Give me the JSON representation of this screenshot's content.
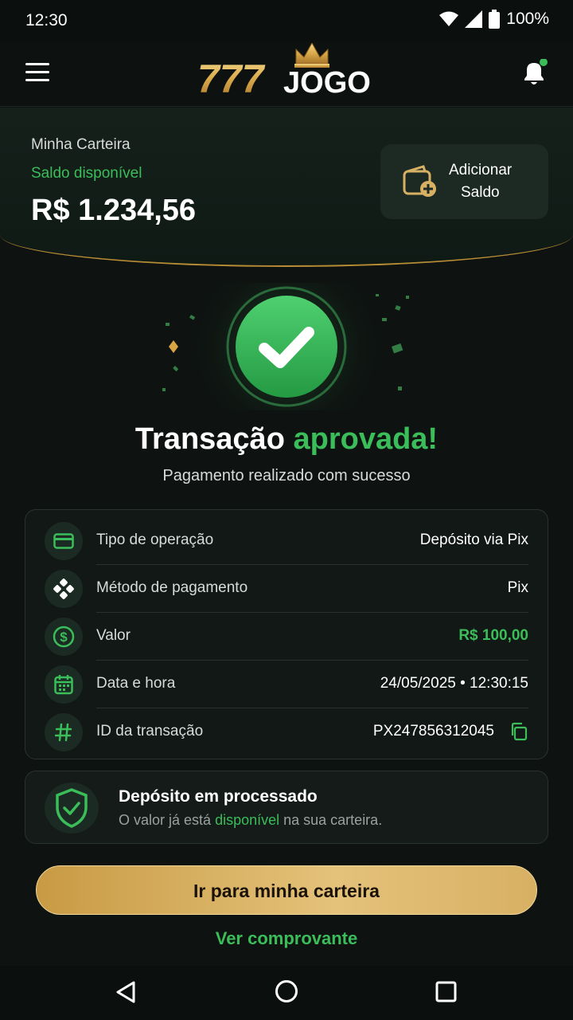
{
  "status_bar": {
    "time": "12:30",
    "battery": "100%"
  },
  "header": {
    "logo_number": "777",
    "logo_word": "JOGO"
  },
  "wallet": {
    "title": "Minha Carteira",
    "subtitle": "Saldo disponível",
    "balance": "R$ 1.234,56",
    "add_line1": "Adicionar",
    "add_line2": "Saldo"
  },
  "success": {
    "title_part1": "Transação",
    "title_part2": "aprovada!",
    "subtitle": "Pagamento realizado com sucesso"
  },
  "details": [
    {
      "label": "Tipo de operação",
      "value": "Depósito via Pix",
      "icon": "card-icon"
    },
    {
      "label": "Método de pagamento",
      "value": "Pix",
      "icon": "pix-icon"
    },
    {
      "label": "Valor",
      "value": "R$ 100,00",
      "icon": "dollar-circle-icon"
    },
    {
      "label": "Data e hora",
      "value": "24/05/2025 • 12:30:15",
      "icon": "calendar-icon"
    },
    {
      "label": "ID da transação",
      "value": "PX247856312045",
      "icon": "hash-icon"
    }
  ],
  "processed": {
    "title": "Depósito em processado",
    "text_before": "O valor já está ",
    "text_highlight": "disponível",
    "text_after": " na sua carteira."
  },
  "actions": {
    "primary": "Ir para minha carteira",
    "secondary": "Ver comprovante"
  },
  "colors": {
    "accent_green": "#3bbd5a",
    "gold": "#d8b064",
    "background": "#0e1311"
  }
}
